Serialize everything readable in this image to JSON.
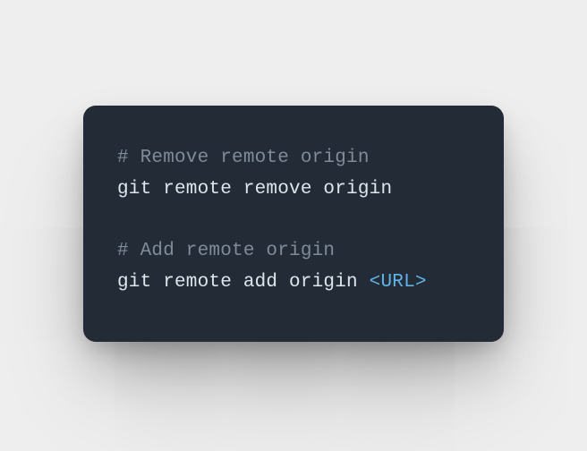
{
  "code": {
    "lines": [
      {
        "kind": "comment",
        "text": "# Remove remote origin"
      },
      {
        "kind": "cmd",
        "text": "git remote remove origin"
      },
      {
        "kind": "blank",
        "text": ""
      },
      {
        "kind": "comment",
        "text": "# Add remote origin"
      },
      {
        "kind": "cmd_with_placeholder",
        "prefix": "git remote add origin ",
        "open": "<",
        "token": "URL",
        "close": ">"
      }
    ]
  }
}
